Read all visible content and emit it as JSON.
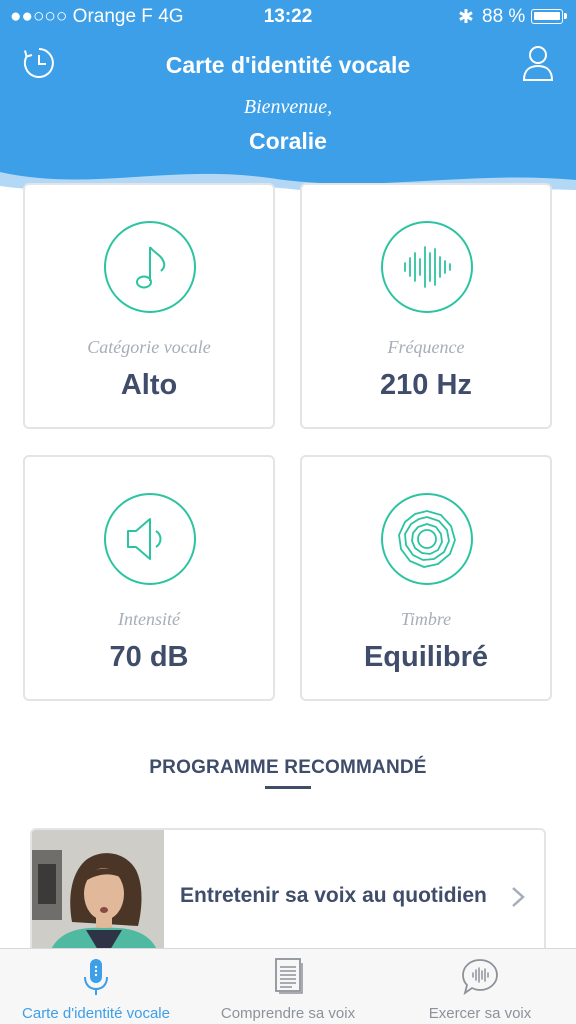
{
  "status_bar": {
    "carrier": "●●○○○ Orange F   4G",
    "time": "13:22",
    "bluetooth": "✱",
    "battery_percent": "88 %",
    "battery_level": 0.88
  },
  "header": {
    "title": "Carte d'identité vocale",
    "welcome": "Bienvenue,",
    "user_name": "Coralie",
    "left_icon": "history-clock-icon",
    "right_icon": "profile-icon"
  },
  "cards": [
    {
      "label": "Catégorie vocale",
      "value": "Alto",
      "icon": "music-note-icon"
    },
    {
      "label": "Fréquence",
      "value": "210 Hz",
      "icon": "waveform-icon"
    },
    {
      "label": "Intensité",
      "value": "70 dB",
      "icon": "speaker-icon"
    },
    {
      "label": "Timbre",
      "value": "Equilibré",
      "icon": "timbre-rings-icon"
    }
  ],
  "recommended": {
    "section_title": "PROGRAMME RECOMMANDÉ",
    "program_title": "Entretenir sa voix au quotidien"
  },
  "tabs": [
    {
      "label": "Carte d'identité vocale",
      "icon": "microphone-icon",
      "active": true
    },
    {
      "label": "Comprendre sa voix",
      "icon": "document-icon",
      "active": false
    },
    {
      "label": "Exercer sa voix",
      "icon": "speech-bubble-icon",
      "active": false
    }
  ],
  "colors": {
    "header_blue": "#3d9fe8",
    "accent_teal": "#2cc3a1",
    "text_dark": "#3f4d6b",
    "text_muted": "#a6adb8"
  }
}
